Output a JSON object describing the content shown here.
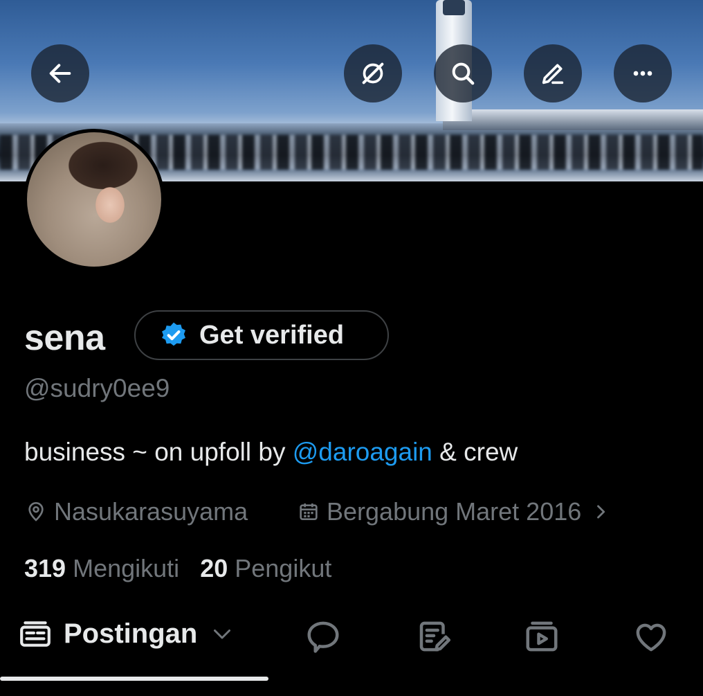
{
  "profile": {
    "name": "sena",
    "handle": "@sudry0ee9",
    "verify_label": "Get verified",
    "bio_text": "business ~ on upfoll by ",
    "bio_mention": "@daroagain",
    "bio_suffix": " & crew",
    "location": "Nasukarasuyama",
    "joined": "Bergabung Maret 2016",
    "following_count": "319",
    "following_label": "Mengikuti",
    "followers_count": "20",
    "followers_label": "Pengikut"
  },
  "tabs": {
    "posts_label": "Postingan"
  },
  "icons": {
    "back": "arrow-left-icon",
    "grok": "grok-icon",
    "search": "search-icon",
    "edit": "pencil-icon",
    "more": "more-icon",
    "location": "location-pin-icon",
    "calendar": "calendar-icon",
    "replies": "chat-bubble-icon",
    "articles": "article-icon",
    "media": "media-icon",
    "likes": "heart-icon"
  },
  "colors": {
    "accent": "#1d9bf0",
    "muted": "#71767b",
    "text": "#e7e9ea",
    "background": "#000000"
  }
}
